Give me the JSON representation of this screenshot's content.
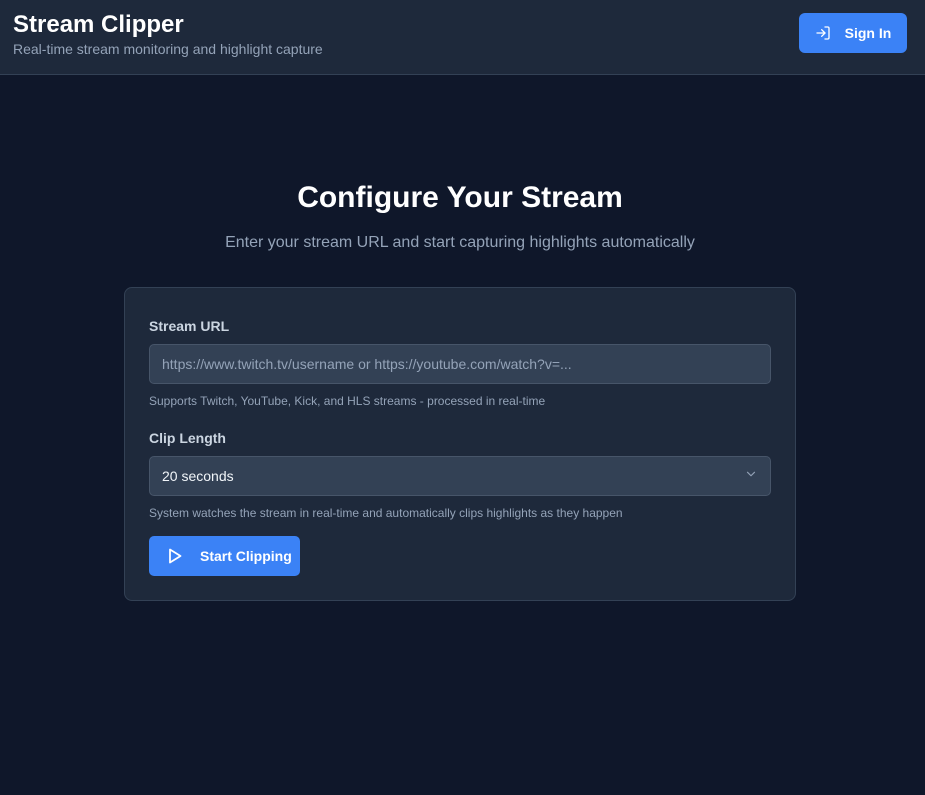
{
  "header": {
    "title": "Stream Clipper",
    "subtitle": "Real-time stream monitoring and highlight capture",
    "signin_label": "Sign In",
    "signin_icon": "log-in-icon"
  },
  "hero": {
    "title": "Configure Your Stream",
    "subtitle": "Enter your stream URL and start capturing highlights automatically"
  },
  "form": {
    "url_label": "Stream URL",
    "url_value": "",
    "url_placeholder": "https://www.twitch.tv/username or https://youtube.com/watch?v=...",
    "url_help": "Supports Twitch, YouTube, Kick, and HLS streams - processed in real-time",
    "clip_length_label": "Clip Length",
    "clip_length_selected": "20 seconds",
    "clip_length_icon": "chevron-down-icon",
    "clip_length_help": "System watches the stream in real-time and automatically clips highlights as they happen",
    "start_label": "Start Clipping",
    "start_icon": "play-icon"
  },
  "colors": {
    "background": "#0f172a",
    "surface": "#1e293b",
    "input": "#334155",
    "accent": "#3b82f6",
    "muted_text": "#94a3b8"
  }
}
